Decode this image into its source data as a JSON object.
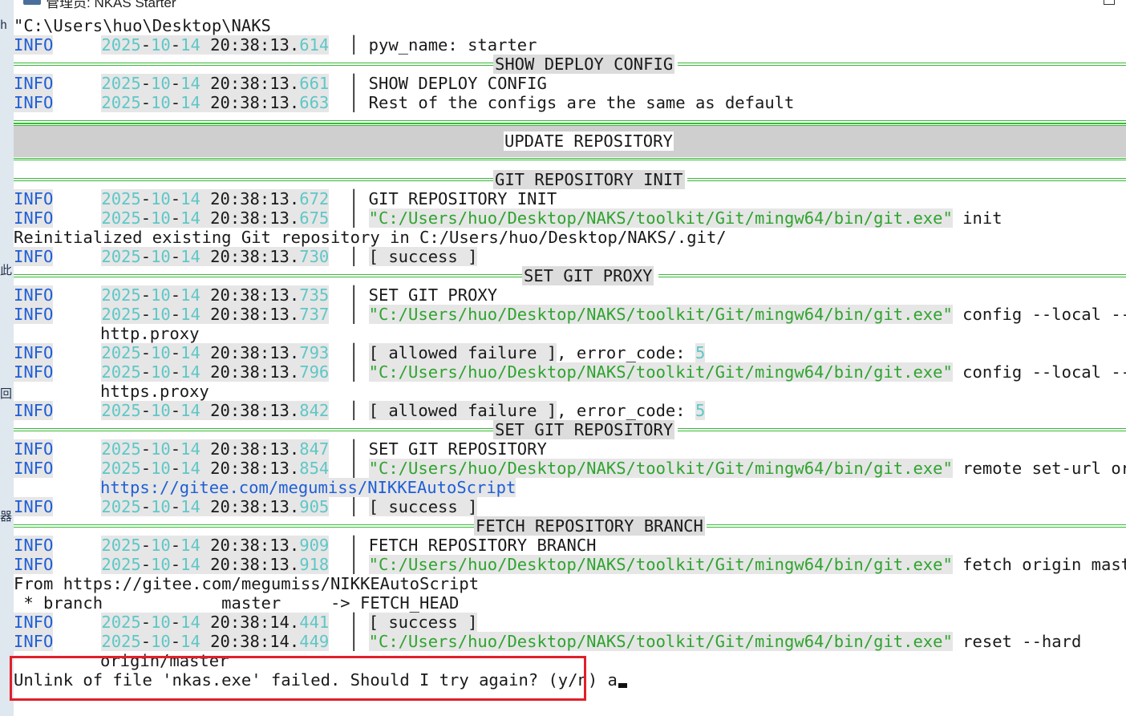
{
  "window": {
    "title": "管理员: NKAS Starter"
  },
  "console": {
    "cwd_line": "\"C:\\Users\\huo\\Desktop\\NAKS",
    "logs": [
      {
        "level": "INFO",
        "y": "2025",
        "m": "10",
        "d": "14",
        "t": "20:38:13",
        "ms": "614",
        "msg": "pyw_name: starter"
      },
      {
        "level": "INFO",
        "y": "2025",
        "m": "10",
        "d": "14",
        "t": "20:38:13",
        "ms": "661",
        "msg": "SHOW DEPLOY CONFIG"
      },
      {
        "level": "INFO",
        "y": "2025",
        "m": "10",
        "d": "14",
        "t": "20:38:13",
        "ms": "663",
        "msg": "Rest of the configs are the same as default"
      },
      {
        "level": "INFO",
        "y": "2025",
        "m": "10",
        "d": "14",
        "t": "20:38:13",
        "ms": "672",
        "msg": "GIT REPOSITORY INIT"
      },
      {
        "level": "INFO",
        "y": "2025",
        "m": "10",
        "d": "14",
        "t": "20:38:13",
        "ms": "675",
        "path": "\"C:/Users/huo/Desktop/NAKS/toolkit/Git/mingw64/bin/git.exe\"",
        "args": " init"
      },
      {
        "level": "INFO",
        "y": "2025",
        "m": "10",
        "d": "14",
        "t": "20:38:13",
        "ms": "730",
        "tag": "success"
      },
      {
        "level": "INFO",
        "y": "2025",
        "m": "10",
        "d": "14",
        "t": "20:38:13",
        "ms": "735",
        "msg": "SET GIT PROXY"
      },
      {
        "level": "INFO",
        "y": "2025",
        "m": "10",
        "d": "14",
        "t": "20:38:13",
        "ms": "737",
        "path": "\"C:/Users/huo/Desktop/NAKS/toolkit/Git/mingw64/bin/git.exe\"",
        "args": " config --local --unse"
      },
      {
        "level": "INFO",
        "y": "2025",
        "m": "10",
        "d": "14",
        "t": "20:38:13",
        "ms": "793",
        "tag": "allowed failure",
        "tail": ", error_code: ",
        "code": "5"
      },
      {
        "level": "INFO",
        "y": "2025",
        "m": "10",
        "d": "14",
        "t": "20:38:13",
        "ms": "796",
        "path": "\"C:/Users/huo/Desktop/NAKS/toolkit/Git/mingw64/bin/git.exe\"",
        "args": " config --local --unse"
      },
      {
        "level": "INFO",
        "y": "2025",
        "m": "10",
        "d": "14",
        "t": "20:38:13",
        "ms": "842",
        "tag": "allowed failure",
        "tail": ", error_code: ",
        "code": "5"
      },
      {
        "level": "INFO",
        "y": "2025",
        "m": "10",
        "d": "14",
        "t": "20:38:13",
        "ms": "847",
        "msg": "SET GIT REPOSITORY"
      },
      {
        "level": "INFO",
        "y": "2025",
        "m": "10",
        "d": "14",
        "t": "20:38:13",
        "ms": "854",
        "path": "\"C:/Users/huo/Desktop/NAKS/toolkit/Git/mingw64/bin/git.exe\"",
        "args": " remote set-url origin"
      },
      {
        "level": "INFO",
        "y": "2025",
        "m": "10",
        "d": "14",
        "t": "20:38:13",
        "ms": "905",
        "tag": "success"
      },
      {
        "level": "INFO",
        "y": "2025",
        "m": "10",
        "d": "14",
        "t": "20:38:13",
        "ms": "909",
        "msg": "FETCH REPOSITORY BRANCH"
      },
      {
        "level": "INFO",
        "y": "2025",
        "m": "10",
        "d": "14",
        "t": "20:38:13",
        "ms": "918",
        "path": "\"C:/Users/huo/Desktop/NAKS/toolkit/Git/mingw64/bin/git.exe\"",
        "args": " fetch origin master"
      },
      {
        "level": "INFO",
        "y": "2025",
        "m": "10",
        "d": "14",
        "t": "20:38:14",
        "ms": "441",
        "tag": "success"
      },
      {
        "level": "INFO",
        "y": "2025",
        "m": "10",
        "d": "14",
        "t": "20:38:14",
        "ms": "449",
        "path": "\"C:/Users/huo/Desktop/NAKS/toolkit/Git/mingw64/bin/git.exe\"",
        "args": " reset --hard"
      }
    ],
    "rules": {
      "show_deploy": "SHOW DEPLOY CONFIG",
      "update_repo": "UPDATE REPOSITORY",
      "git_init": "GIT REPOSITORY INIT",
      "set_proxy": "SET GIT PROXY",
      "set_repo": "SET GIT REPOSITORY",
      "fetch_branch": "FETCH REPOSITORY BRANCH"
    },
    "plain": {
      "reinit": "Reinitialized existing Git repository in C:/Users/huo/Desktop/NAKS/.git/",
      "http_proxy": "http.proxy",
      "https_proxy": "https.proxy",
      "repo_url": "https://gitee.com/megumiss/NIKKEAutoScript",
      "from": "From https://gitee.com/megumiss/NIKKEAutoScript",
      "branch": " * branch            master     -> FETCH_HEAD",
      "origin_master": "origin/master"
    },
    "prompt": {
      "text": "Unlink of file 'nkas.exe' failed. Should I try again? (y/n) ",
      "input": "a"
    },
    "desktop_glyphs": [
      "h",
      "此",
      "回",
      "器"
    ]
  },
  "colors": {
    "level": "#1f5fd6",
    "timestamp": "#5fc7c7",
    "path": "#2fa42f",
    "rule": "#39b839",
    "highlight_box": "#e0202a"
  }
}
